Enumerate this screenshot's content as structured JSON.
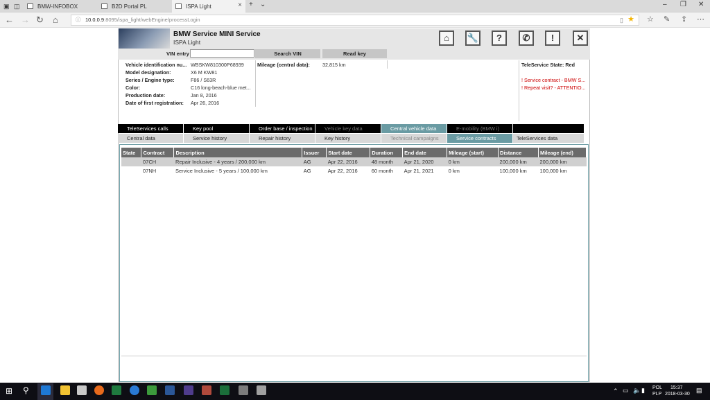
{
  "browser": {
    "tabs": [
      {
        "label": "BMW-INFOBOX"
      },
      {
        "label": "B2D Portal PL"
      },
      {
        "label": "ISPA Light"
      }
    ],
    "url_host": "10.0.0.9",
    "url_path": ":8095/ispa_light/webEngine/processLogin"
  },
  "app": {
    "title": "BMW Service MINI Service",
    "subtitle": "ISPA Light",
    "vin_label": "VIN entry",
    "vin_value": "",
    "search_vin": "Search VIN",
    "read_key": "Read key"
  },
  "vehicle": {
    "fields": [
      {
        "label": "Vehicle identification nu...",
        "value": "WBSKW810300P68939"
      },
      {
        "label": "Model designation:",
        "value": "X6 M KW81"
      },
      {
        "label": "Series / Engine type:",
        "value": "F86 / S63R"
      },
      {
        "label": "Color:",
        "value": "C16 long-beach-blue met..."
      },
      {
        "label": "Production date:",
        "value": "Jan 8, 2016"
      },
      {
        "label": "Date of first registration:",
        "value": "Apr 26, 2016"
      }
    ],
    "mileage_label": "Mileage (central data):",
    "mileage_value": "32,815 km",
    "teleservice_state": "TeleService State: Red",
    "alerts": [
      "! Service contract - BMW S...",
      "! Repeat visit? - ATTENTIO..."
    ]
  },
  "tabs_row1": [
    {
      "label": "TeleServices calls"
    },
    {
      "label": "Key pool"
    },
    {
      "label": "Order base / inspection"
    },
    {
      "label": "Vehicle key data"
    },
    {
      "label": "Central vehicle data"
    },
    {
      "label": "E-mobility (BMW i)"
    }
  ],
  "tabs_row2": [
    {
      "label": "Central data"
    },
    {
      "label": "Service history"
    },
    {
      "label": "Repair history"
    },
    {
      "label": "Key history"
    },
    {
      "label": "Technical campaigns"
    },
    {
      "label": "Service contracts"
    },
    {
      "label": "TeleServices data"
    }
  ],
  "table": {
    "headers": [
      "State",
      "Contract",
      "Description",
      "Issuer",
      "Start date",
      "Duration",
      "End date",
      "Mileage (start)",
      "Distance",
      "Mileage (end)"
    ],
    "rows": [
      [
        "",
        "07CH",
        "Repair Inclusive - 4 years / 200,000 km",
        "AG",
        "Apr 22, 2016",
        "48 month",
        "Apr 21, 2020",
        "0 km",
        "200,000 km",
        "200,000 km"
      ],
      [
        "",
        "07NH",
        "Service Inclusive - 5 years / 100,000 km",
        "AG",
        "Apr 22, 2016",
        "60 month",
        "Apr 21, 2021",
        "0 km",
        "100,000 km",
        "100,000 km"
      ]
    ]
  },
  "taskbar": {
    "lang1": "POL",
    "lang2": "PLP",
    "time": "15:37",
    "date": "2018-03-30"
  },
  "colors": {
    "teal": "#6a9ba3",
    "alert_red": "#cc0000"
  }
}
